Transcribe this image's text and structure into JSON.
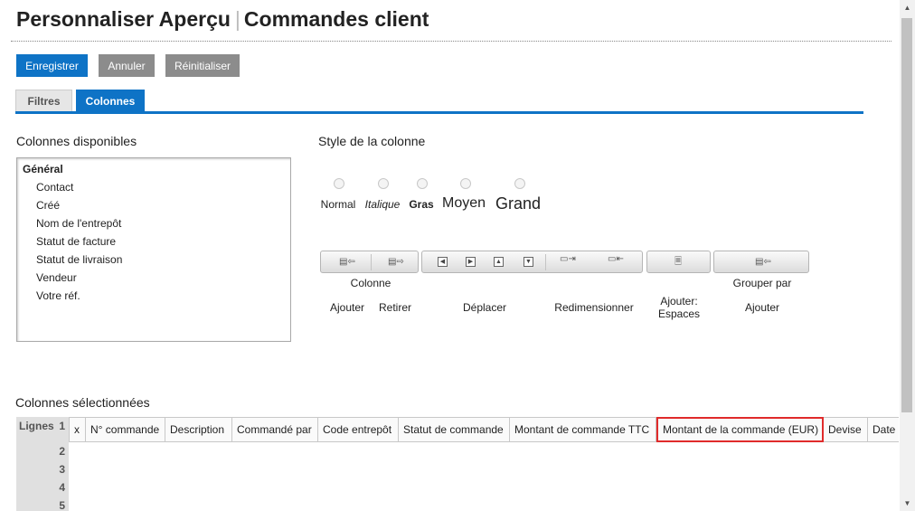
{
  "header": {
    "title_left": "Personnaliser Aperçu",
    "separator": "|",
    "title_right": "Commandes client"
  },
  "toolbar": {
    "save_label": "Enregistrer",
    "cancel_label": "Annuler",
    "reset_label": "Réinitialiser"
  },
  "tabs": [
    {
      "label": "Filtres",
      "active": false
    },
    {
      "label": "Colonnes",
      "active": true
    }
  ],
  "available": {
    "label": "Colonnes disponibles",
    "group": "Général",
    "items": [
      "Contact",
      "Créé",
      "Nom de l'entrepôt",
      "Statut de facture",
      "Statut de livraison",
      "Vendeur",
      "Votre réf."
    ]
  },
  "style": {
    "label": "Style de la colonne",
    "options": [
      "Normal",
      "Italique",
      "Gras",
      "Moyen",
      "Grand"
    ]
  },
  "actions": {
    "colonne_label": "Colonne",
    "grouper_label": "Grouper par",
    "ajouter": "Ajouter",
    "retirer": "Retirer",
    "deplacer": "Déplacer",
    "redimensionner": "Redimensionner",
    "ajouter_espaces_1": "Ajouter:",
    "ajouter_espaces_2": "Espaces",
    "grouper_ajouter": "Ajouter"
  },
  "selected": {
    "label": "Colonnes sélectionnées",
    "rows_label": "Lignes",
    "row_numbers": [
      "1",
      "2",
      "3",
      "4",
      "5"
    ],
    "columns": [
      "x",
      "N° commande",
      "Description",
      "Commandé par",
      "Code entrepôt",
      "Statut de commande",
      "Montant de commande TTC",
      "Montant de la commande (EUR)",
      "Devise",
      "Date de"
    ],
    "highlighted_column": "Montant de la commande (EUR)"
  },
  "colors": {
    "primary": "#0e73c6",
    "secondary": "#8c8c8c",
    "highlight": "#e02b2b"
  }
}
